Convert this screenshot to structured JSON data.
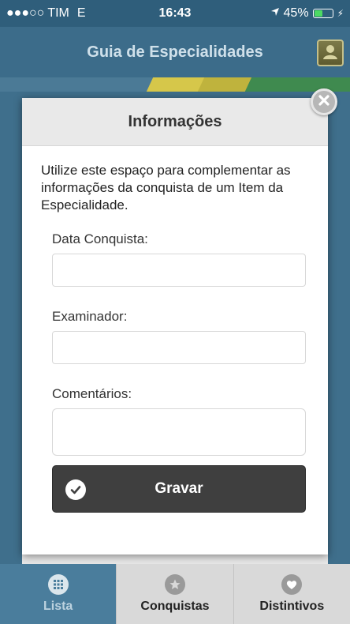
{
  "status_bar": {
    "carrier": "TIM",
    "network": "E",
    "time": "16:43",
    "battery_percent": "45%",
    "battery_level": 0.45
  },
  "header": {
    "title": "Guia de Especialidades"
  },
  "dialog": {
    "title": "Informações",
    "intro": "Utilize este espaço para complementar as informações da conquista de um Item da Especialidade.",
    "fields": {
      "date_label": "Data Conquista:",
      "date_value": "",
      "examiner_label": "Examinador:",
      "examiner_value": "",
      "comments_label": "Comentários:",
      "comments_value": ""
    },
    "save_label": "Gravar"
  },
  "tabs": [
    {
      "label": "Lista",
      "icon": "grid-icon",
      "active": true
    },
    {
      "label": "Conquistas",
      "icon": "star-icon",
      "active": false
    },
    {
      "label": "Distintivos",
      "icon": "heart-icon",
      "active": false
    }
  ],
  "colors": {
    "header_bg": "#3c6c8a",
    "status_bg": "#2f5e7b",
    "active_tab": "#4a7d9c",
    "button_dark": "#3f3f3f",
    "battery": "#4cd964"
  }
}
